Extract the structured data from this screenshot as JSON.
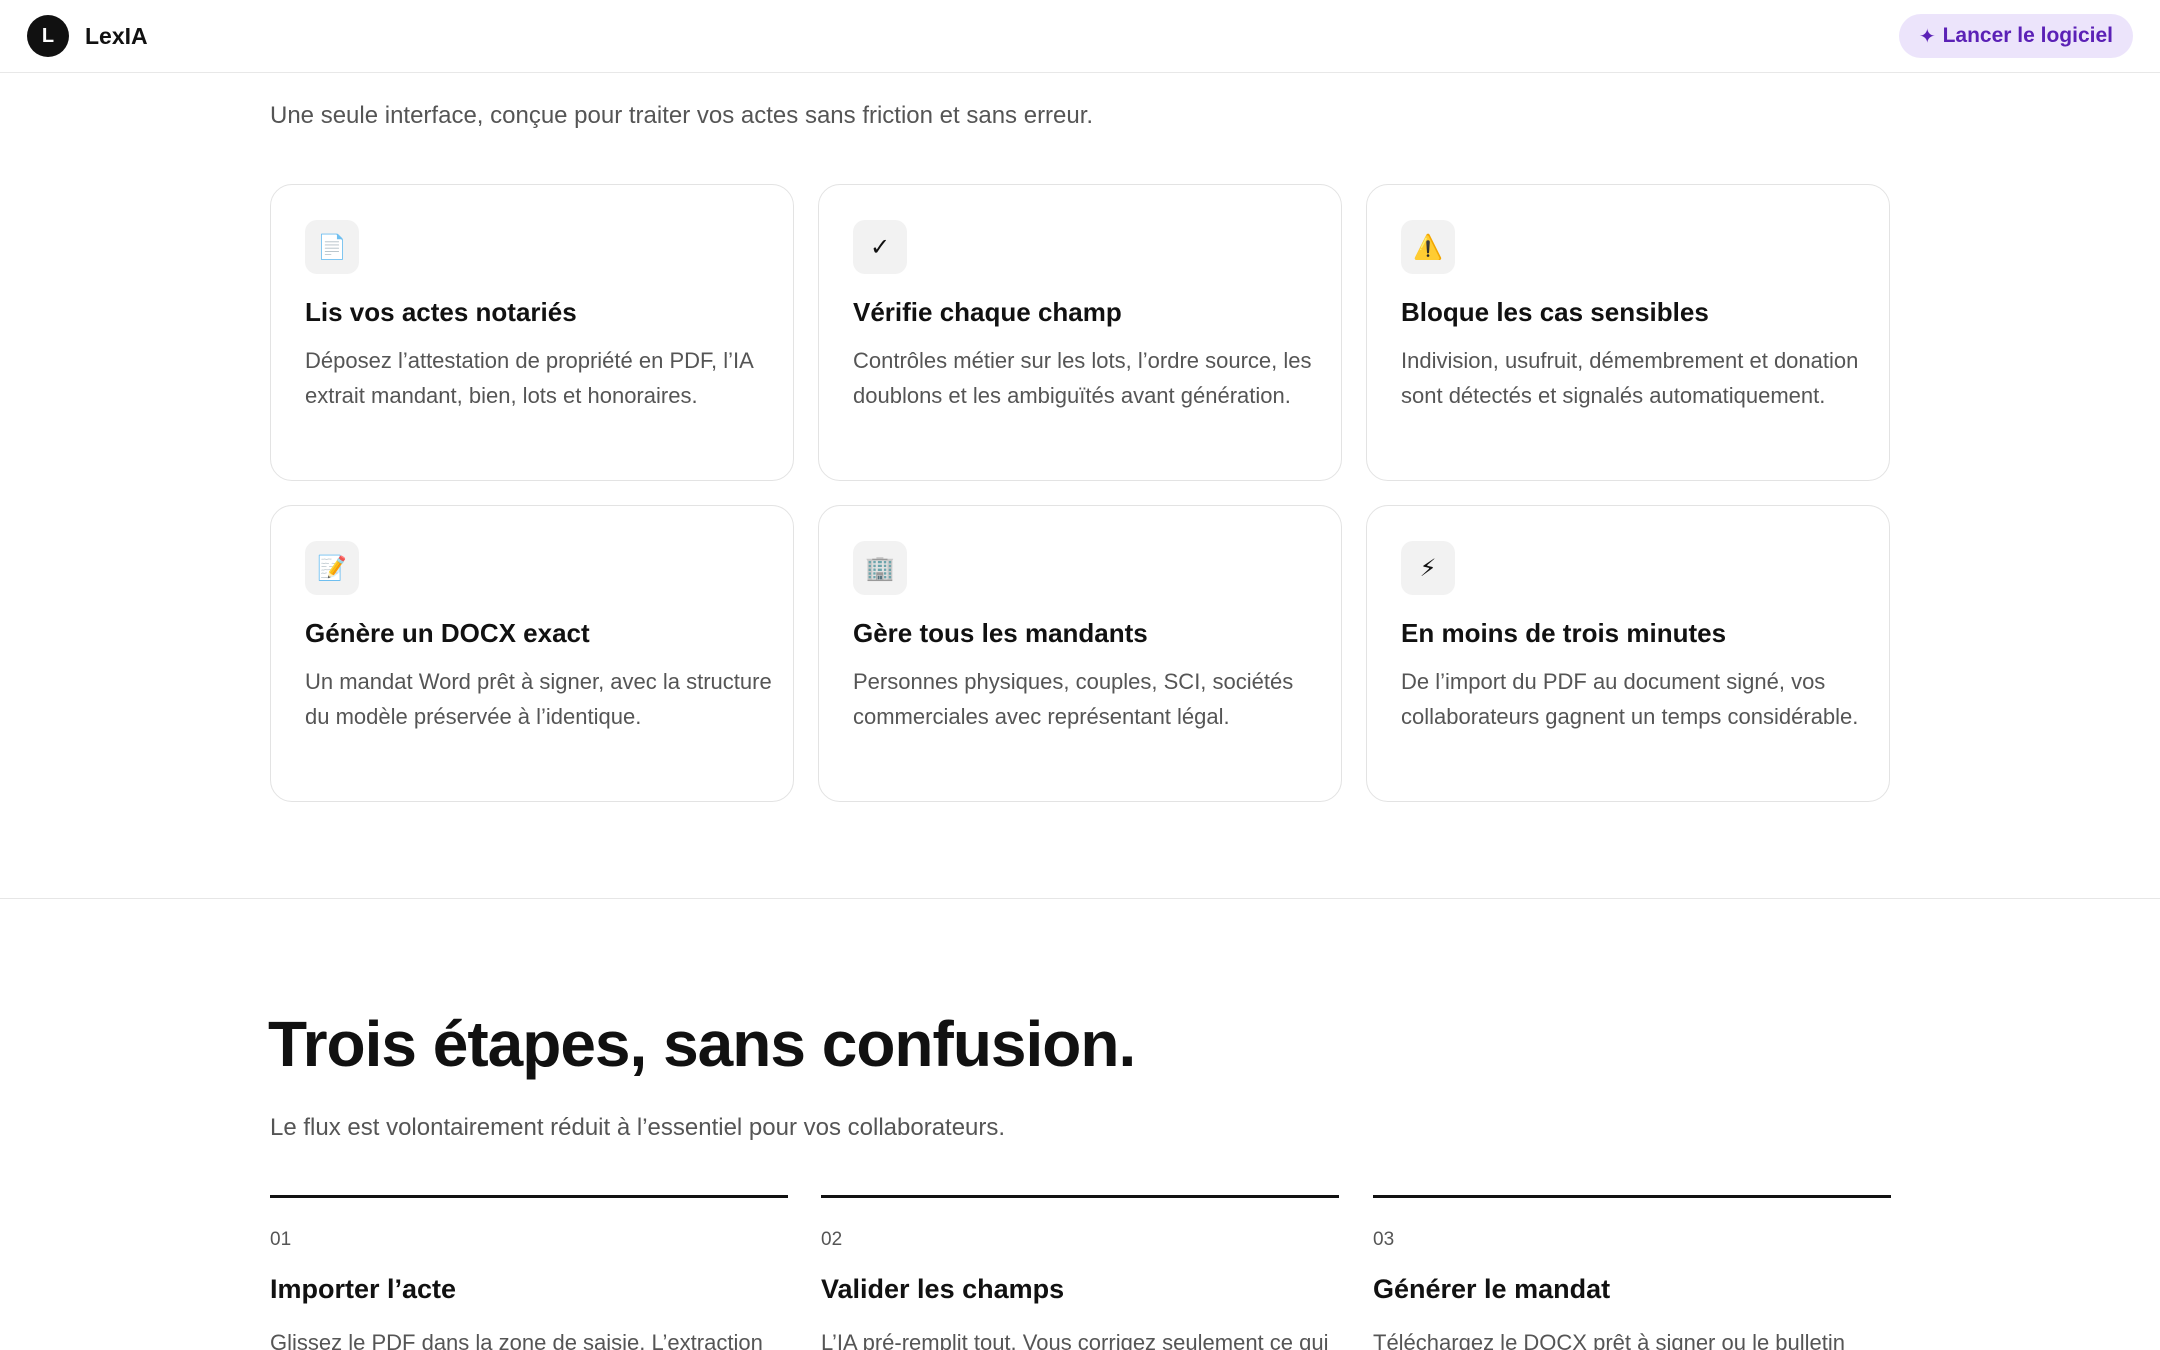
{
  "header": {
    "logo_letter": "L",
    "brand": "LexIA",
    "launch_icon": "✦",
    "launch_label": "Lancer le logiciel"
  },
  "features": {
    "subtitle": "Une seule interface, conçue pour traiter vos actes sans friction et sans erreur.",
    "cards": [
      {
        "icon": "📄",
        "icon_name": "document-icon",
        "title": "Lis vos actes notariés",
        "text": "Déposez l’attestation de propriété en PDF, l’IA extrait mandant, bien, lots et honoraires."
      },
      {
        "icon": "✓",
        "icon_name": "checkmark-icon",
        "title": "Vérifie chaque champ",
        "text": "Contrôles métier sur les lots, l’ordre source, les doublons et les ambiguïtés avant génération."
      },
      {
        "icon": "⚠️",
        "icon_name": "warning-icon",
        "title": "Bloque les cas sensibles",
        "text": "Indivision, usufruit, démembrement et donation sont détectés et signalés automatiquement."
      },
      {
        "icon": "📝",
        "icon_name": "memo-icon",
        "title": "Génère un DOCX exact",
        "text": "Un mandat Word prêt à signer, avec la structure du modèle préservée à l’identique."
      },
      {
        "icon": "🏢",
        "icon_name": "office-building-icon",
        "title": "Gère tous les mandants",
        "text": "Personnes physiques, couples, SCI, sociétés commerciales avec représentant légal."
      },
      {
        "icon": "⚡",
        "icon_name": "lightning-icon",
        "title": "En moins de trois minutes",
        "text": "De l’import du PDF au document signé, vos collaborateurs gagnent un temps considérable."
      }
    ]
  },
  "steps": {
    "title": "Trois étapes, sans confusion.",
    "subtitle": "Le flux est volontairement réduit à l’essentiel pour vos collaborateurs.",
    "items": [
      {
        "num": "01",
        "title": "Importer l’acte",
        "text": "Glissez le PDF dans la zone de saisie. L’extraction"
      },
      {
        "num": "02",
        "title": "Valider les champs",
        "text": "L’IA pré-remplit tout. Vous corrigez seulement ce qui"
      },
      {
        "num": "03",
        "title": "Générer le mandat",
        "text": "Téléchargez le DOCX prêt à signer ou le bulletin"
      }
    ]
  },
  "colors": {
    "accent_bg": "#ece4fb",
    "accent_text": "#5b21b6",
    "text_primary": "#111111",
    "text_secondary": "#555555",
    "card_border": "#e3e3e3"
  }
}
